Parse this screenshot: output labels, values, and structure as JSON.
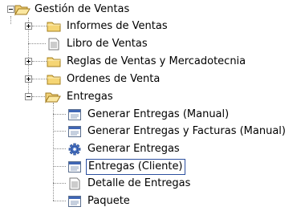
{
  "tree": {
    "root": {
      "label": "Gestión de Ventas",
      "expanded": true,
      "icon": "open-folder-icon"
    },
    "children": [
      {
        "label": "Informes de Ventas",
        "icon": "folder-icon",
        "expander": "plus"
      },
      {
        "label": "Libro de Ventas",
        "icon": "document-icon"
      },
      {
        "label": "Reglas de Ventas y Mercadotecnia",
        "icon": "folder-icon",
        "expander": "plus"
      },
      {
        "label": "Ordenes de Venta",
        "icon": "folder-icon",
        "expander": "plus"
      },
      {
        "label": "Entregas",
        "icon": "open-folder-icon",
        "expander": "minus",
        "children": [
          {
            "label": "Generar Entregas (Manual)",
            "icon": "window-icon"
          },
          {
            "label": "Generar Entregas y Facturas (Manual)",
            "icon": "window-icon"
          },
          {
            "label": "Generar Entregas",
            "icon": "gear-icon"
          },
          {
            "label": "Entregas (Cliente)",
            "icon": "window-icon",
            "selected": true
          },
          {
            "label": "Detalle de Entregas",
            "icon": "document-icon"
          },
          {
            "label": "Paquete",
            "icon": "window-icon"
          }
        ]
      }
    ]
  }
}
